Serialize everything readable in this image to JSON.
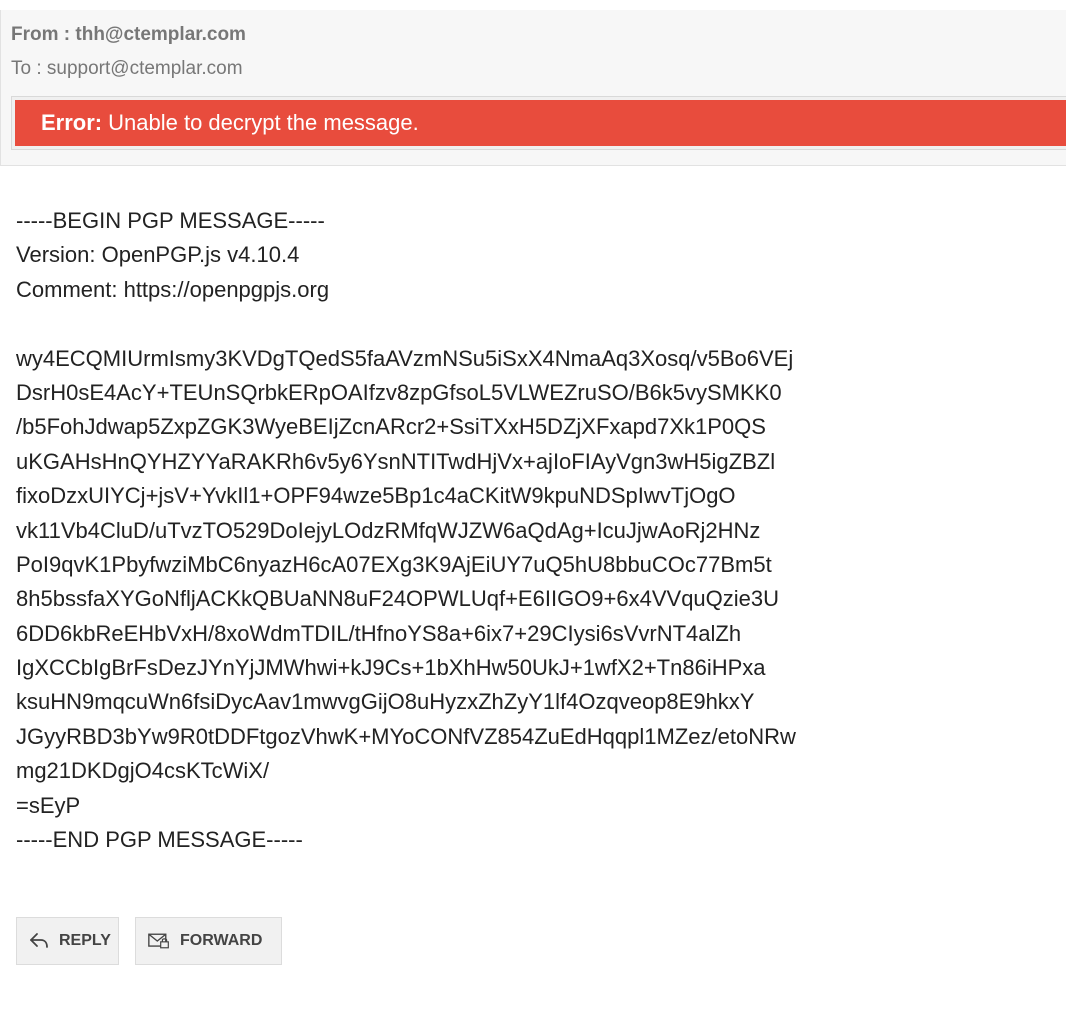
{
  "header": {
    "from_label": "From : ",
    "from_value": "thh@ctemplar.com",
    "to_label": "To : ",
    "to_value": "support@ctemplar.com"
  },
  "error": {
    "label": "Error:",
    "message": "Unable to decrypt the message."
  },
  "pgp": {
    "lines": [
      "-----BEGIN PGP MESSAGE-----",
      "Version: OpenPGP.js v4.10.4",
      "Comment: https://openpgpjs.org",
      "",
      "wy4ECQMIUrmIsmy3KVDgTQedS5faAVzmNSu5iSxX4NmaAq3Xosq/v5Bo6VEj",
      "DsrH0sE4AcY+TEUnSQrbkERpOAIfzv8zpGfsoL5VLWEZruSO/B6k5vySMKK0",
      "/b5FohJdwap5ZxpZGK3WyeBEIjZcnARcr2+SsiTXxH5DZjXFxapd7Xk1P0QS",
      "uKGAHsHnQYHZYYaRAKRh6v5y6YsnNTITwdHjVx+ajIoFIAyVgn3wH5igZBZl",
      "fixoDzxUIYCj+jsV+YvkIl1+OPF94wze5Bp1c4aCKitW9kpuNDSpIwvTjOgO",
      "vk11Vb4CluD/uTvzTO529DoIejyLOdzRMfqWJZW6aQdAg+IcuJjwAoRj2HNz",
      "PoI9qvK1PbyfwziMbC6nyazH6cA07EXg3K9AjEiUY7uQ5hU8bbuCOc77Bm5t",
      "8h5bssfaXYGoNfljACKkQBUaNN8uF24OPWLUqf+E6IIGO9+6x4VVquQzie3U",
      "6DD6kbReEHbVxH/8xoWdmTDIL/tHfnoYS8a+6ix7+29CIysi6sVvrNT4alZh",
      "IgXCCbIgBrFsDezJYnYjJMWhwi+kJ9Cs+1bXhHw50UkJ+1wfX2+Tn86iHPxa",
      "ksuHN9mqcuWn6fsiDycAav1mwvgGijO8uHyzxZhZyY1lf4Ozqveop8E9hkxY",
      "JGyyRBD3bYw9R0tDDFtgozVhwK+MYoCONfVZ854ZuEdHqqpl1MZez/etoNRw",
      "mg21DKDgjO4csKTcWiX/",
      "=sEyP",
      "-----END PGP MESSAGE-----"
    ]
  },
  "actions": {
    "reply_label": "REPLY",
    "forward_label": "FORWARD",
    "reply_icon": "reply-arrow-icon",
    "forward_icon": "envelope-lock-icon"
  },
  "colors": {
    "error_background": "#e84c3d",
    "header_background": "#f7f7f7",
    "button_background": "#f1f1f1"
  }
}
